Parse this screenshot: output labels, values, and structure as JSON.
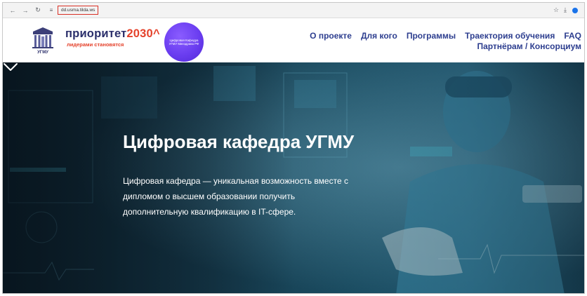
{
  "browser": {
    "back_icon": "arrow-left-icon",
    "forward_icon": "arrow-right-icon",
    "reload_icon": "reload-icon",
    "url": "dd.usma.tilda.ws",
    "bookmark_icon": "star-icon",
    "download_icon": "download-icon"
  },
  "header": {
    "logo_text": "УГМУ",
    "brand_name_text": "приоритет",
    "brand_name_num": "2030",
    "brand_name_mark": "^",
    "brand_tagline": "лидерами становятся",
    "badge_text": "Цифровая Кафедра УГМУ Минздрава РФ",
    "nav_row1": [
      "О проекте",
      "Для кого",
      "Программы",
      "Траектория обучения",
      "FAQ"
    ],
    "nav_row2": [
      "Партнёрам / Консорциум"
    ]
  },
  "hero": {
    "title": "Цифровая кафедра УГМУ",
    "description": "Цифровая кафедра — уникальная возможность вместе с дипломом о высшем образовании получить дополнительную квалификацию в IT-сфере.",
    "scroll_icon": "chevron-down-icon"
  },
  "colors": {
    "brand_navy": "#2b2f6b",
    "brand_red": "#e4412a",
    "nav_blue": "#2d3e8f",
    "badge_purple": "#6a3df0",
    "url_highlight": "#d93025"
  }
}
